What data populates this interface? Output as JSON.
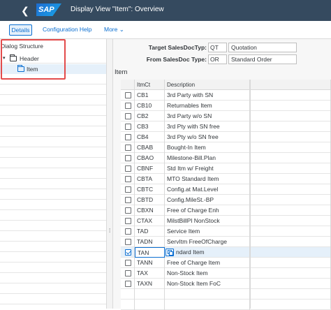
{
  "shell": {
    "title": "Display View \"Item\": Overview",
    "logo_text": "SAP",
    "back_glyph": "❮",
    "colors": {
      "shell_bg": "#354a5f",
      "accent": "#0a6ed1",
      "highlight_box": "#e34b4b"
    }
  },
  "toolbar": {
    "details_label": "Details",
    "config_help_label": "Configuration Help",
    "more_label": "More",
    "more_glyph": "⌄"
  },
  "dialog_structure": {
    "title": "Dialog Structure",
    "nodes": [
      {
        "label": "Header",
        "expander": "▾",
        "icon": "folder-icon"
      },
      {
        "label": "Item",
        "icon": "folder-open-icon",
        "selected": true
      }
    ]
  },
  "form": {
    "target_label": "Target SalesDocTyp:",
    "target_code": "QT",
    "target_desc": "Quotation",
    "from_label": "From SalesDoc Type:",
    "from_code": "OR",
    "from_desc": "Standard Order"
  },
  "section_title": "Item",
  "table": {
    "headers": {
      "code": "ItmCt",
      "desc": "Description"
    },
    "rows": [
      {
        "code": "CB1",
        "desc": "3rd Party with SN",
        "checked": false
      },
      {
        "code": "CB10",
        "desc": "Returnables Item",
        "checked": false
      },
      {
        "code": "CB2",
        "desc": "3rd Party w/o SN",
        "checked": false
      },
      {
        "code": "CB3",
        "desc": "3rd Pty with SN free",
        "checked": false
      },
      {
        "code": "CB4",
        "desc": "3rd Pty w/o SN free",
        "checked": false
      },
      {
        "code": "CBAB",
        "desc": "Bought-In Item",
        "checked": false
      },
      {
        "code": "CBAO",
        "desc": "Milestone-Bill.Plan",
        "checked": false
      },
      {
        "code": "CBNF",
        "desc": "Std Itm w/ Freight",
        "checked": false
      },
      {
        "code": "CBTA",
        "desc": "MTO Standard Item",
        "checked": false
      },
      {
        "code": "CBTC",
        "desc": "Config.at Mat.Level",
        "checked": false
      },
      {
        "code": "CBTD",
        "desc": "Config.MileSt.-BP",
        "checked": false
      },
      {
        "code": "CBXN",
        "desc": "Free of Charge Enh",
        "checked": false
      },
      {
        "code": "CTAX",
        "desc": "MilstBillPl NonStock",
        "checked": false
      },
      {
        "code": "TAD",
        "desc": "Service Item",
        "checked": false
      },
      {
        "code": "TADN",
        "desc": "ServItm FreeOfCharge",
        "checked": false
      },
      {
        "code": "TAN",
        "desc": "ndard Item",
        "checked": true,
        "selected": true
      },
      {
        "code": "TANN",
        "desc": "Free of Charge Item",
        "checked": false
      },
      {
        "code": "TAX",
        "desc": "Non-Stock Item",
        "checked": false
      },
      {
        "code": "TAXN",
        "desc": "Non-Stock Item FoC",
        "checked": false
      },
      {
        "code": "",
        "desc": "",
        "checked": false
      },
      {
        "code": "",
        "desc": "",
        "checked": false
      }
    ]
  },
  "splitter_glyph": "⁞"
}
